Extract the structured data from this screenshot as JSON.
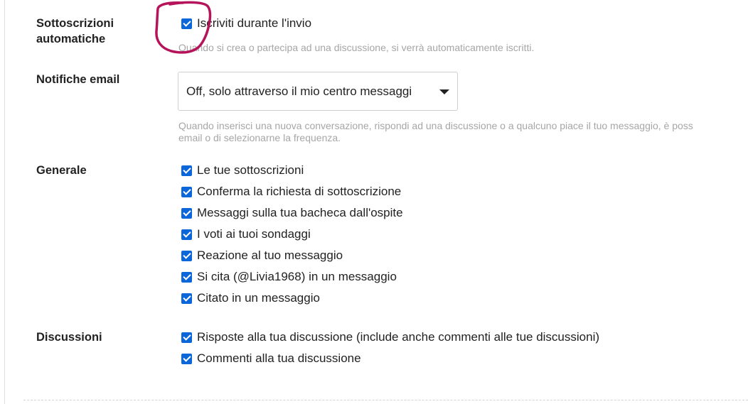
{
  "auto_subscriptions": {
    "label_line1": "Sottoscrizioni",
    "label_line2": "automatiche",
    "option": "Iscriviti durante l'invio",
    "option_checked": true,
    "hint": "Quando si crea o partecipa ad una discussione, si verrà automaticamente iscritti."
  },
  "email_notifications": {
    "label": "Notifiche email",
    "selected": "Off, solo attraverso il mio centro messaggi",
    "hint_line1": "Quando inserisci una nuova conversazione, rispondi ad una discussione o a qualcuno piace il tuo messaggio, è poss",
    "hint_line2": "email o di selezionarne la frequenza."
  },
  "general": {
    "label": "Generale",
    "options": [
      {
        "label": "Le tue sottoscrizioni",
        "checked": true
      },
      {
        "label": "Conferma la richiesta di sottoscrizione",
        "checked": true
      },
      {
        "label": "Messaggi sulla tua bacheca dall'ospite",
        "checked": true
      },
      {
        "label": "I voti ai tuoi sondaggi",
        "checked": true
      },
      {
        "label": "Reazione al tuo messaggio",
        "checked": true
      },
      {
        "label": "Si cita (@Livia1968) in un messaggio",
        "checked": true
      },
      {
        "label": "Citato in un messaggio",
        "checked": true
      }
    ]
  },
  "discussions": {
    "label": "Discussioni",
    "options": [
      {
        "label": "Risposte alla tua discussione (include anche commenti alle tue discussioni)",
        "checked": true
      },
      {
        "label": "Commenti alla tua discussione",
        "checked": true
      }
    ]
  },
  "colors": {
    "checkbox": "#0a66d9",
    "annotation": "#b5135a",
    "hint": "#a6a6a6"
  },
  "icons": {
    "select_caret": "caret-down-icon",
    "checkbox": "checkbox-checked-icon"
  }
}
